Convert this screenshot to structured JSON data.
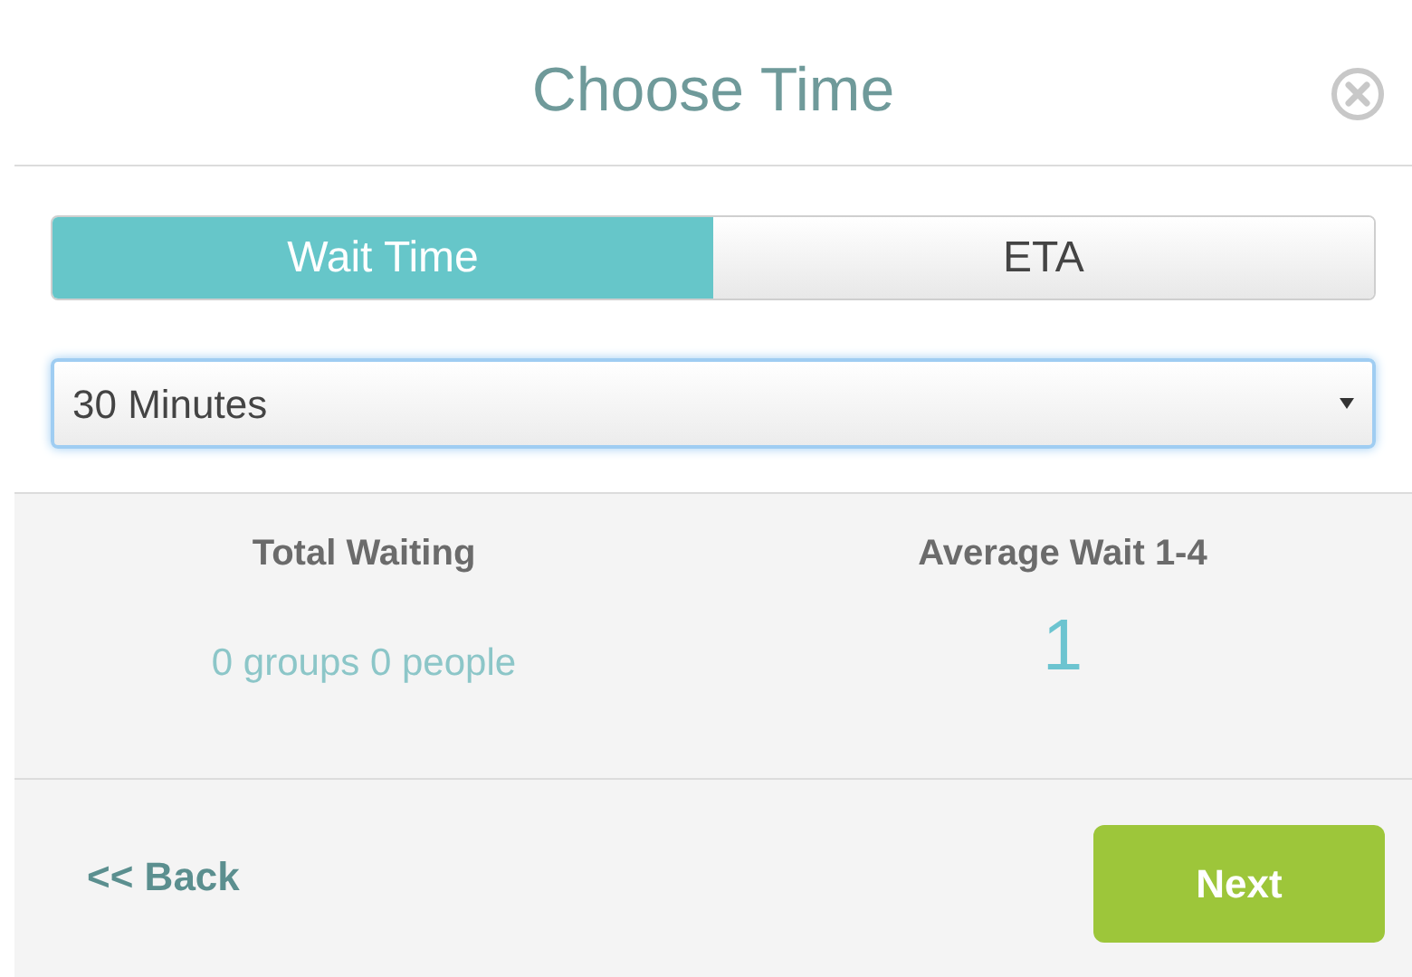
{
  "dialog": {
    "title": "Choose Time"
  },
  "tabs": [
    {
      "label": "Wait Time",
      "selected": true
    },
    {
      "label": "ETA",
      "selected": false
    }
  ],
  "select": {
    "value": "30 Minutes"
  },
  "stats": [
    {
      "label": "Total Waiting",
      "value": "0 groups 0 people",
      "kind": "small"
    },
    {
      "label": "Average Wait 1-4",
      "value": "1",
      "kind": "large"
    }
  ],
  "footer": {
    "back": "<< Back",
    "next": "Next"
  }
}
